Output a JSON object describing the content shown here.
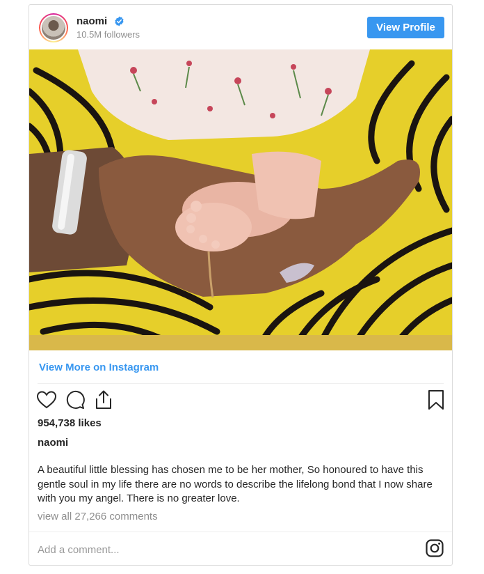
{
  "post": {
    "username": "naomi",
    "followers": "10.5M followers",
    "view_profile_label": "View Profile",
    "view_more_label": "View More on Instagram",
    "likes": "954,738 likes",
    "caption_username": "naomi",
    "caption_text": "A beautiful little blessing has chosen me to be her mother, So honoured to have this gentle soul in my life there are no words to describe the lifelong bond that I now share with you my angel. There is no greater love.",
    "view_comments": "view all 27,266 comments",
    "comment_placeholder": "Add a comment..."
  },
  "colors": {
    "accent": "#3897f0",
    "text": "#262626",
    "muted": "#8e8e8e",
    "border": "#dbdbdb"
  },
  "icons": {
    "verified": "verified-badge-icon",
    "like": "heart-icon",
    "comment": "comment-bubble-icon",
    "share": "share-icon",
    "save": "bookmark-icon",
    "instagram": "instagram-logo-icon"
  }
}
